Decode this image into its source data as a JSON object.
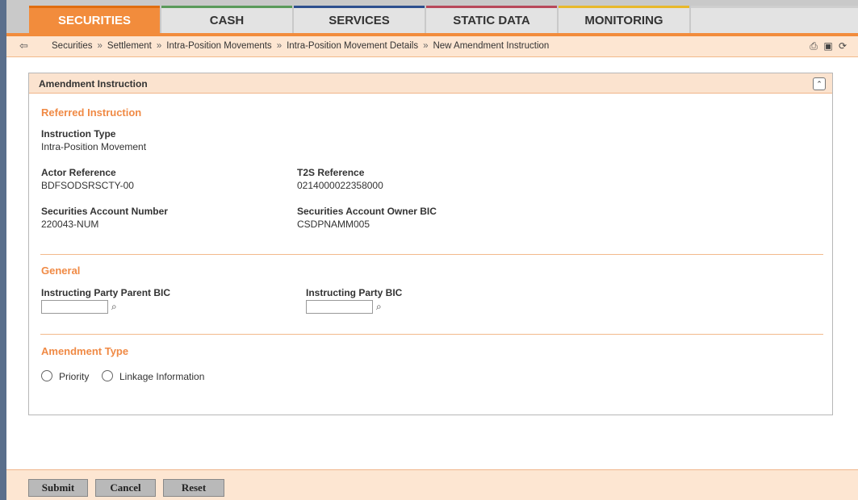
{
  "nav": {
    "tabs": [
      {
        "label": "SECURITIES",
        "active": true
      },
      {
        "label": "CASH"
      },
      {
        "label": "SERVICES"
      },
      {
        "label": "STATIC DATA"
      },
      {
        "label": "MONITORING"
      }
    ],
    "active_color": "#f28c3c"
  },
  "breadcrumb": {
    "items": [
      "Securities",
      "Settlement",
      "Intra-Position Movements",
      "Intra-Position Movement Details",
      "New Amendment Instruction"
    ],
    "separator": "»"
  },
  "toolbar_icons": [
    "print-icon",
    "save-icon",
    "refresh-icon"
  ],
  "panel": {
    "title": "Amendment Instruction",
    "referred": {
      "title": "Referred Instruction",
      "instruction_type_label": "Instruction Type",
      "instruction_type_value": "Intra-Position Movement",
      "actor_reference_label": "Actor Reference",
      "actor_reference_value": "BDFSODSRSCTY-00",
      "t2s_reference_label": "T2S Reference",
      "t2s_reference_value": "0214000022358000",
      "sec_account_label": "Securities Account Number",
      "sec_account_value": "220043-NUM",
      "owner_bic_label": "Securities Account Owner BIC",
      "owner_bic_value": "CSDPNAMM005"
    },
    "general": {
      "title": "General",
      "parent_bic_label": "Instructing Party Parent BIC",
      "parent_bic_value": "",
      "party_bic_label": "Instructing Party BIC",
      "party_bic_value": ""
    },
    "amendment": {
      "title": "Amendment Type",
      "options": [
        "Priority",
        "Linkage Information"
      ]
    }
  },
  "buttons": {
    "submit": "Submit",
    "cancel": "Cancel",
    "reset": "Reset"
  }
}
